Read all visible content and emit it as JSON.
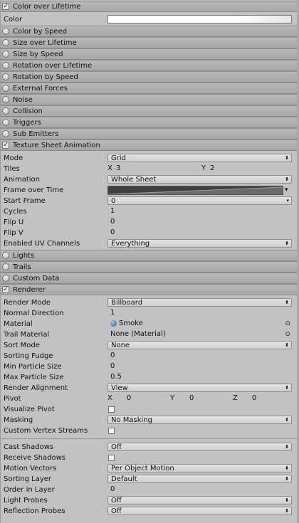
{
  "sections": {
    "color_over_lifetime": "Color over Lifetime",
    "color_by_speed": "Color by Speed",
    "size_over_lifetime": "Size over Lifetime",
    "size_by_speed": "Size by Speed",
    "rotation_over_lifetime": "Rotation over Lifetime",
    "rotation_by_speed": "Rotation by Speed",
    "external_forces": "External Forces",
    "noise": "Noise",
    "collision": "Collision",
    "triggers": "Triggers",
    "sub_emitters": "Sub Emitters",
    "texture_sheet_animation": "Texture Sheet Animation",
    "lights": "Lights",
    "trails": "Trails",
    "custom_data": "Custom Data",
    "renderer": "Renderer"
  },
  "color_row": {
    "label": "Color"
  },
  "tsa": {
    "mode": {
      "label": "Mode",
      "value": "Grid"
    },
    "tiles": {
      "label": "Tiles",
      "x_label": "X",
      "x": "3",
      "y_label": "Y",
      "y": "2"
    },
    "animation": {
      "label": "Animation",
      "value": "Whole Sheet"
    },
    "frame_over_time": {
      "label": "Frame over Time"
    },
    "start_frame": {
      "label": "Start Frame",
      "value": "0"
    },
    "cycles": {
      "label": "Cycles",
      "value": "1"
    },
    "flip_u": {
      "label": "Flip U",
      "value": "0"
    },
    "flip_v": {
      "label": "Flip V",
      "value": "0"
    },
    "uv_channels": {
      "label": "Enabled UV Channels",
      "value": "Everything"
    }
  },
  "renderer": {
    "render_mode": {
      "label": "Render Mode",
      "value": "Billboard"
    },
    "normal_direction": {
      "label": "Normal Direction",
      "value": "1"
    },
    "material": {
      "label": "Material",
      "value": "Smoke"
    },
    "trail_material": {
      "label": "Trail Material",
      "value": "None (Material)"
    },
    "sort_mode": {
      "label": "Sort Mode",
      "value": "None"
    },
    "sorting_fudge": {
      "label": "Sorting Fudge",
      "value": "0"
    },
    "min_particle_size": {
      "label": "Min Particle Size",
      "value": "0"
    },
    "max_particle_size": {
      "label": "Max Particle Size",
      "value": "0.5"
    },
    "render_alignment": {
      "label": "Render Alignment",
      "value": "View"
    },
    "pivot": {
      "label": "Pivot",
      "x_label": "X",
      "x": "0",
      "y_label": "Y",
      "y": "0",
      "z_label": "Z",
      "z": "0"
    },
    "visualize_pivot": {
      "label": "Visualize Pivot"
    },
    "masking": {
      "label": "Masking",
      "value": "No Masking"
    },
    "custom_vertex_streams": {
      "label": "Custom Vertex Streams"
    },
    "cast_shadows": {
      "label": "Cast Shadows",
      "value": "Off"
    },
    "receive_shadows": {
      "label": "Receive Shadows"
    },
    "motion_vectors": {
      "label": "Motion Vectors",
      "value": "Per Object Motion"
    },
    "sorting_layer": {
      "label": "Sorting Layer",
      "value": "Default"
    },
    "order_in_layer": {
      "label": "Order in Layer",
      "value": "0"
    },
    "light_probes": {
      "label": "Light Probes",
      "value": "Off"
    },
    "reflection_probes": {
      "label": "Reflection Probes",
      "value": "Off"
    }
  },
  "glyphs": {
    "check": "✓",
    "dropdown": "⬍",
    "picker": "⊙",
    "menu": "▾"
  },
  "colors": {
    "background": "#c2c2c2",
    "header": "#adadad"
  }
}
